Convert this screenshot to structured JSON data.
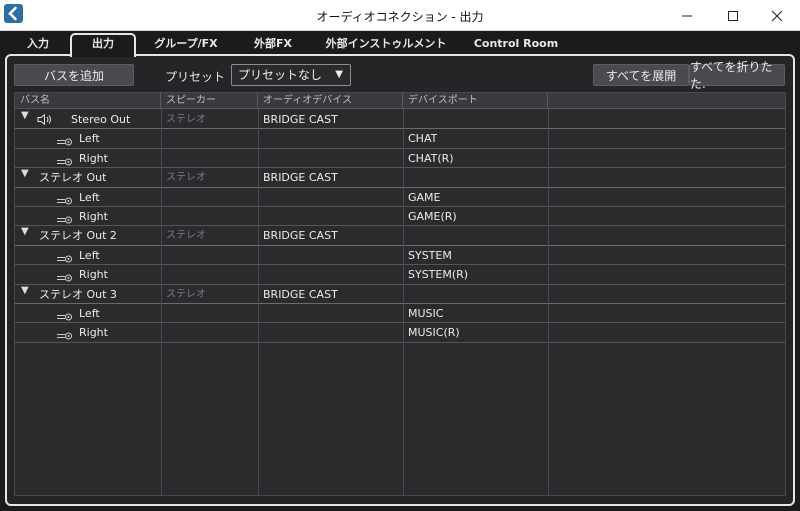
{
  "window": {
    "title": "オーディオコネクション - 出力",
    "controls": {
      "minimize": "minimize",
      "maximize": "maximize",
      "close": "close"
    }
  },
  "tabs": [
    {
      "label": "入力",
      "active": false
    },
    {
      "label": "出力",
      "active": true
    },
    {
      "label": "グループ/FX",
      "active": false
    },
    {
      "label": "外部FX",
      "active": false
    },
    {
      "label": "外部インストゥルメント",
      "active": false
    },
    {
      "label": "Control Room",
      "active": false
    }
  ],
  "toolbar": {
    "add_bus_label": "バスを追加",
    "preset_label": "プリセット",
    "preset_value": "プリセットなし",
    "expand_all_label": "すべてを展開",
    "collapse_all_label": "すべてを折りたた."
  },
  "table": {
    "columns": [
      "バス名",
      "スピーカー",
      "オーディオデバイス",
      "デバイスポート",
      ""
    ],
    "buses": [
      {
        "name": "Stereo Out",
        "speaker": "ステレオ",
        "device": "BRIDGE CAST",
        "has_speaker_icon": true,
        "channels": [
          {
            "name": "Left",
            "port": "CHAT"
          },
          {
            "name": "Right",
            "port": "CHAT(R)"
          }
        ]
      },
      {
        "name": "ステレオ Out",
        "speaker": "ステレオ",
        "device": "BRIDGE CAST",
        "has_speaker_icon": false,
        "channels": [
          {
            "name": "Left",
            "port": "GAME"
          },
          {
            "name": "Right",
            "port": "GAME(R)"
          }
        ]
      },
      {
        "name": "ステレオ Out 2",
        "speaker": "ステレオ",
        "device": "BRIDGE CAST",
        "has_speaker_icon": false,
        "channels": [
          {
            "name": "Left",
            "port": "SYSTEM"
          },
          {
            "name": "Right",
            "port": "SYSTEM(R)"
          }
        ]
      },
      {
        "name": "ステレオ Out 3",
        "speaker": "ステレオ",
        "device": "BRIDGE CAST",
        "has_speaker_icon": false,
        "channels": [
          {
            "name": "Left",
            "port": "MUSIC"
          },
          {
            "name": "Right",
            "port": "MUSIC(R)"
          }
        ]
      }
    ]
  },
  "colors": {
    "accent": "#2b6fa8",
    "panel_border": "#e6e6e6",
    "background": "#1b1b1d"
  }
}
